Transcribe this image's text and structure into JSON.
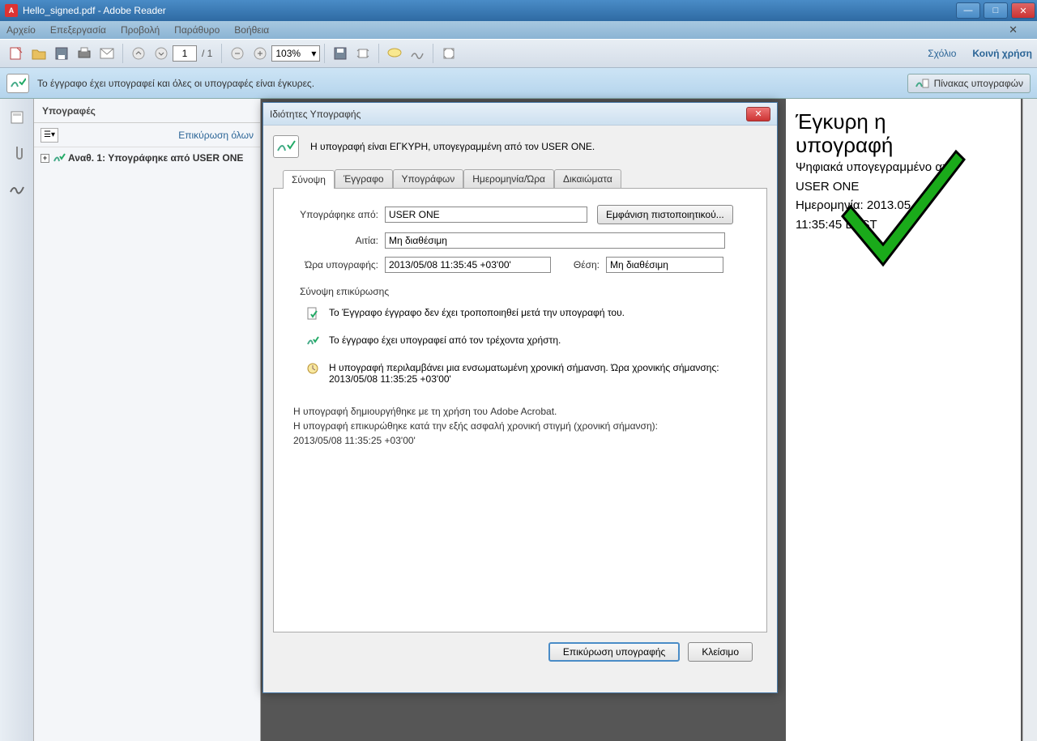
{
  "titlebar": {
    "title": "Hello_signed.pdf - Adobe Reader"
  },
  "menubar": {
    "items": [
      "Αρχείο",
      "Επεξεργασία",
      "Προβολή",
      "Παράθυρο",
      "Βοήθεια"
    ]
  },
  "toolbar": {
    "page_current": "1",
    "page_sep": "/ 1",
    "zoom": "103%",
    "comment_link": "Σχόλιο",
    "share_link": "Κοινή χρήση"
  },
  "sig_msgbar": {
    "text": "Το έγγραφο έχει υπογραφεί και όλες οι υπογραφές είναι έγκυρες.",
    "panel_btn": "Πίνακας υπογραφών"
  },
  "sig_panel": {
    "title": "Υπογραφές",
    "validate_all": "Επικύρωση όλων",
    "tree_item": "Αναθ. 1: Υπογράφηκε από USER ONE"
  },
  "doc": {
    "title_l1": "Έγκυρη η",
    "title_l2": "υπογραφή",
    "line1": "Ψηφιακά υπογεγραμμένο από",
    "line2": "USER ONE",
    "line3": "Ημερομηνία: 2013.05.08",
    "line4": "11:35:45 EEST"
  },
  "dialog": {
    "title": "Ιδιότητες Υπογραφής",
    "sig_valid_msg": "Η υπογραφή είναι ΕΓΚΥΡΗ, υπογεγραμμένη από τον USER ONE.",
    "tabs": [
      "Σύνοψη",
      "Έγγραφο",
      "Υπογράφων",
      "Ημερομηνία/Ώρα",
      "Δικαιώματα"
    ],
    "labels": {
      "signed_by": "Υπογράφηκε από:",
      "reason": "Αιτία:",
      "sign_time": "Ώρα υπογραφής:",
      "location": "Θέση:"
    },
    "values": {
      "signed_by": "USER ONE",
      "reason": "Μη διαθέσιμη",
      "sign_time": "2013/05/08 11:35:45 +03'00'",
      "location": "Μη διαθέσιμη"
    },
    "show_cert_btn": "Εμφάνιση πιστοποιητικού...",
    "group_title": "Σύνοψη επικύρωσης",
    "summary": [
      "Το Έγγραφο έγγραφο δεν έχει τροποποιηθεί μετά την υπογραφή του.",
      "Το έγγραφο έχει υπογραφεί από τον τρέχοντα χρήστη.",
      "Η υπογραφή περιλαμβάνει μια ενσωματωμένη χρονική σήμανση. Ώρα χρονικής σήμανσης:\n2013/05/08 11:35:25 +03'00'"
    ],
    "footer_l1": "Η υπογραφή δημιουργήθηκε με τη χρήση του Adobe Acrobat.",
    "footer_l2": "Η υπογραφή επικυρώθηκε κατά την εξής ασφαλή χρονική στιγμή (χρονική σήμανση):",
    "footer_l3": "2013/05/08 11:35:25 +03'00'",
    "btn_validate": "Επικύρωση υπογραφής",
    "btn_close": "Κλείσιμο"
  }
}
